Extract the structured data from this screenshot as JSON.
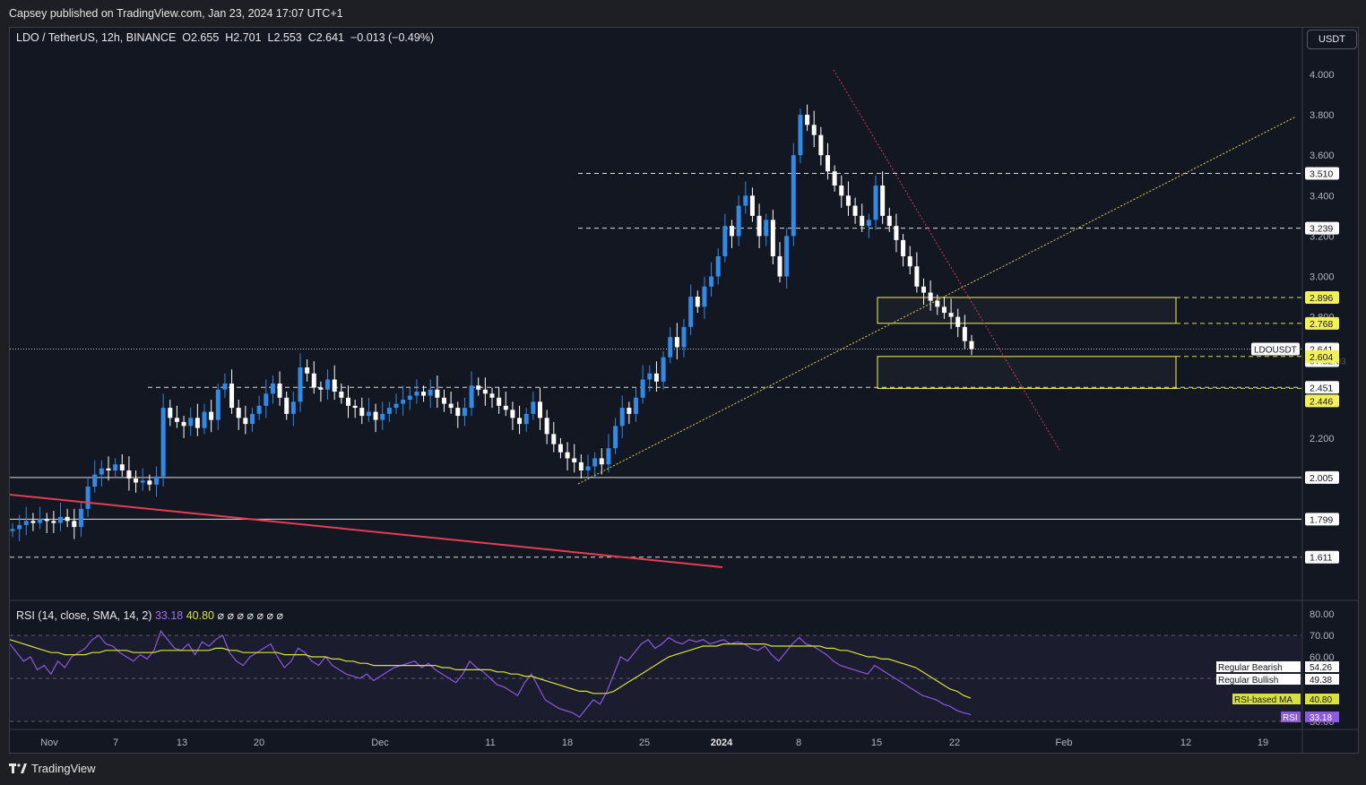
{
  "header": {
    "published_text": "Capsey published on TradingView.com, Jan 23, 2024 17:07 UTC+1"
  },
  "legend": {
    "symbol": "LDO / TetherUS, 12h, BINANCE",
    "open": "O2.655",
    "high": "H2.701",
    "low": "L2.553",
    "close": "C2.641",
    "change": "−0.013 (−0.49%)"
  },
  "currency_button": "USDT",
  "rsi_legend": {
    "label": "RSI (14, close, SMA, 14, 2)",
    "rsi_value": "33.18",
    "ma_value": "40.80",
    "placeholders": "⌀ ⌀ ⌀ ⌀ ⌀ ⌀ ⌀"
  },
  "footer": {
    "brand": "TradingView"
  },
  "colors": {
    "background": "#131722",
    "bull": "#2f8ae8",
    "bear": "#ffffff",
    "rsi_line": "#8a5ae0",
    "rsi_ma": "#d7e33a",
    "accent_yellow": "#f4f157",
    "trend_red": "#e53d54"
  },
  "chart_data": [
    {
      "type": "candlestick",
      "symbol": "LDOUSDT",
      "timeframe": "12h",
      "y_axis_ticks": [
        "4.000",
        "3.800",
        "3.600",
        "3.400",
        "3.200",
        "3.000",
        "2.800",
        "2.200"
      ],
      "x_axis_ticks": [
        "Nov",
        "7",
        "13",
        "20",
        "Dec",
        "11",
        "18",
        "25",
        "2024",
        "8",
        "15",
        "22",
        "Feb",
        "12",
        "19"
      ],
      "horizontal_levels": [
        3.51,
        3.239,
        2.896,
        2.768,
        2.604,
        2.451,
        2.446,
        2.005,
        1.799,
        1.611
      ],
      "price_labels": [
        {
          "text": "3.510",
          "style": "plain"
        },
        {
          "text": "3.239",
          "style": "plain"
        },
        {
          "text": "2.896",
          "style": "yellow"
        },
        {
          "text": "2.768",
          "style": "yellow"
        },
        {
          "text": "2.641",
          "style": "last"
        },
        {
          "text": "07:52:03",
          "style": "countdown"
        },
        {
          "text": "2.604",
          "style": "yellow"
        },
        {
          "text": "2.451",
          "style": "plain"
        },
        {
          "text": "2.446",
          "style": "yellow"
        },
        {
          "text": "2.005",
          "style": "plain"
        },
        {
          "text": "1.799",
          "style": "plain"
        },
        {
          "text": "1.611",
          "style": "plain"
        }
      ],
      "symbol_tag": "LDOUSDT",
      "last_price": 2.641,
      "zones": [
        {
          "top": 2.896,
          "bottom": 2.768
        },
        {
          "top": 2.604,
          "bottom": 2.446
        }
      ],
      "closes": [
        1.75,
        1.77,
        1.79,
        1.78,
        1.8,
        1.79,
        1.78,
        1.81,
        1.79,
        1.76,
        1.85,
        1.96,
        2.02,
        2.05,
        2.04,
        2.07,
        2.04,
        2.0,
        1.98,
        1.99,
        1.97,
        2.01,
        2.35,
        2.3,
        2.28,
        2.26,
        2.3,
        2.25,
        2.33,
        2.29,
        2.44,
        2.47,
        2.35,
        2.3,
        2.27,
        2.32,
        2.36,
        2.42,
        2.47,
        2.4,
        2.32,
        2.38,
        2.55,
        2.52,
        2.45,
        2.44,
        2.49,
        2.43,
        2.4,
        2.36,
        2.35,
        2.31,
        2.33,
        2.29,
        2.32,
        2.35,
        2.37,
        2.39,
        2.41,
        2.43,
        2.41,
        2.44,
        2.4,
        2.37,
        2.35,
        2.31,
        2.35,
        2.46,
        2.44,
        2.42,
        2.4,
        2.36,
        2.34,
        2.3,
        2.27,
        2.32,
        2.38,
        2.3,
        2.22,
        2.17,
        2.13,
        2.1,
        2.08,
        2.04,
        2.06,
        2.1,
        2.07,
        2.15,
        2.26,
        2.35,
        2.32,
        2.4,
        2.49,
        2.52,
        2.48,
        2.6,
        2.7,
        2.65,
        2.75,
        2.9,
        2.85,
        2.95,
        3.0,
        3.1,
        3.25,
        3.2,
        3.35,
        3.4,
        3.3,
        3.2,
        3.28,
        3.1,
        3.0,
        3.2,
        3.6,
        3.8,
        3.75,
        3.7,
        3.6,
        3.52,
        3.45,
        3.4,
        3.35,
        3.3,
        3.25,
        3.28,
        3.45,
        3.3,
        3.25,
        3.18,
        3.1,
        3.05,
        2.95,
        2.92,
        2.88,
        2.85,
        2.82,
        2.8,
        2.75,
        2.68,
        2.641
      ],
      "rsi_axis_ticks": [
        "80.00",
        "70.00",
        "60.00",
        "30.00"
      ],
      "rsi_labels": [
        {
          "name": "Regular Bearish",
          "value": "54.26"
        },
        {
          "name": "Regular Bullish",
          "value": "49.38"
        },
        {
          "name": "RSI-based MA",
          "value": "40.80"
        },
        {
          "name": "RSI",
          "value": "33.18"
        }
      ],
      "rsi_series": [
        66,
        62,
        58,
        60,
        54,
        56,
        52,
        58,
        55,
        60,
        62,
        64,
        68,
        70,
        66,
        65,
        62,
        60,
        58,
        61,
        59,
        63,
        72,
        68,
        64,
        63,
        66,
        61,
        67,
        65,
        68,
        70,
        62,
        58,
        56,
        60,
        62,
        64,
        66,
        60,
        55,
        58,
        64,
        62,
        58,
        56,
        60,
        56,
        54,
        52,
        51,
        50,
        52,
        49,
        51,
        53,
        55,
        56,
        57,
        58,
        55,
        57,
        54,
        52,
        50,
        48,
        52,
        58,
        55,
        53,
        50,
        47,
        46,
        44,
        42,
        48,
        52,
        46,
        40,
        38,
        36,
        35,
        34,
        32,
        36,
        40,
        38,
        44,
        52,
        60,
        58,
        62,
        66,
        68,
        64,
        66,
        69,
        67,
        66,
        68,
        67,
        68,
        66,
        67,
        68,
        66,
        67,
        66,
        64,
        63,
        65,
        61,
        58,
        62,
        66,
        69,
        66,
        65,
        63,
        61,
        58,
        56,
        55,
        54,
        53,
        52,
        56,
        54,
        52,
        50,
        48,
        46,
        44,
        42,
        41,
        40,
        38,
        37,
        35,
        34,
        33.18
      ],
      "rsi_ma_series": [
        68,
        67,
        66,
        65,
        64,
        63,
        62,
        62,
        61,
        61,
        61,
        61,
        62,
        62,
        63,
        63,
        63,
        63,
        62,
        62,
        62,
        62,
        63,
        63,
        63,
        63,
        63,
        63,
        63,
        63,
        64,
        64,
        63,
        63,
        62,
        62,
        62,
        62,
        62,
        62,
        61,
        61,
        61,
        61,
        60,
        60,
        60,
        59,
        59,
        58,
        58,
        57,
        57,
        56,
        56,
        56,
        56,
        56,
        56,
        56,
        56,
        56,
        56,
        55,
        55,
        54,
        54,
        54,
        54,
        54,
        54,
        53,
        53,
        52,
        52,
        51,
        51,
        50,
        49,
        48,
        47,
        46,
        45,
        44,
        44,
        43,
        43,
        43,
        44,
        46,
        48,
        50,
        52,
        54,
        56,
        58,
        60,
        61,
        62,
        63,
        64,
        65,
        65,
        65,
        66,
        66,
        66,
        66,
        66,
        66,
        66,
        65,
        65,
        65,
        65,
        65,
        65,
        65,
        65,
        64,
        64,
        63,
        63,
        62,
        61,
        60,
        60,
        59,
        59,
        58,
        57,
        56,
        55,
        53,
        51,
        49,
        47,
        45,
        44,
        42,
        40.8
      ]
    }
  ]
}
